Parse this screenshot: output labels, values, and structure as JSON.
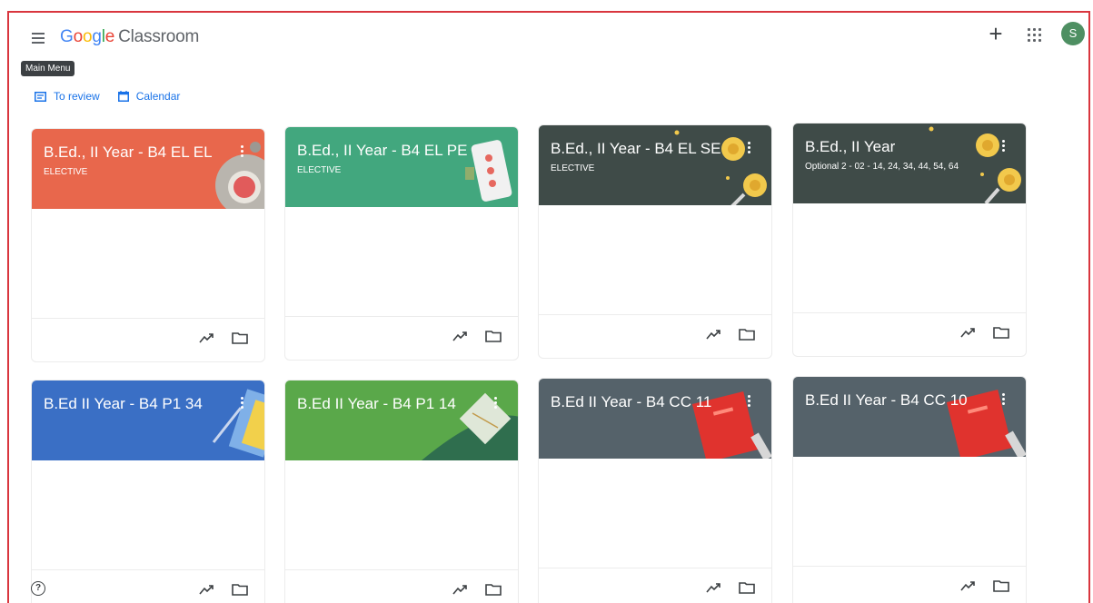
{
  "header": {
    "logo_google": [
      "G",
      "o",
      "o",
      "g",
      "l",
      "e"
    ],
    "logo_product": "Classroom",
    "tooltip": "Main Menu",
    "avatar_initial": "S"
  },
  "subnav": {
    "to_review": "To review",
    "calendar": "Calendar"
  },
  "colors": {
    "coral": "#e8674c",
    "teal": "#42a77e",
    "slate": "#3f4b48",
    "blue": "#3a6fc5",
    "green": "#5aa84a",
    "grey": "#55626a",
    "accent_border": "#d9363e"
  },
  "cards": [
    {
      "title": "B.Ed., II Year - B4 EL EL",
      "subtitle": "ELECTIVE",
      "theme": "coral"
    },
    {
      "title": "B.Ed., II Year - B4 EL PE",
      "subtitle": "ELECTIVE",
      "theme": "teal"
    },
    {
      "title": "B.Ed., II Year - B4 EL SE",
      "subtitle": "ELECTIVE",
      "theme": "slate"
    },
    {
      "title": "B.Ed., II Year",
      "subtitle": "Optional 2 - 02 - 14, 24, 34, 44, 54, 64",
      "theme": "slate"
    },
    {
      "title": "B.Ed II Year - B4 P1 34",
      "subtitle": "",
      "theme": "blue"
    },
    {
      "title": "B.Ed II Year - B4 P1 14",
      "subtitle": "",
      "theme": "green"
    },
    {
      "title": "B.Ed II Year - B4 CC 11",
      "subtitle": "",
      "theme": "grey"
    },
    {
      "title": "B.Ed II Year - B4 CC 10",
      "subtitle": "",
      "theme": "grey"
    }
  ],
  "icons": {
    "menu": "hamburger-menu-icon",
    "create": "plus-icon",
    "apps": "apps-grid-icon",
    "to_review": "assignment-icon",
    "calendar": "calendar-icon",
    "card_more": "kebab-menu-icon",
    "gradebook": "trending-up-icon",
    "drive": "folder-icon",
    "help": "help-icon"
  },
  "help": "?"
}
